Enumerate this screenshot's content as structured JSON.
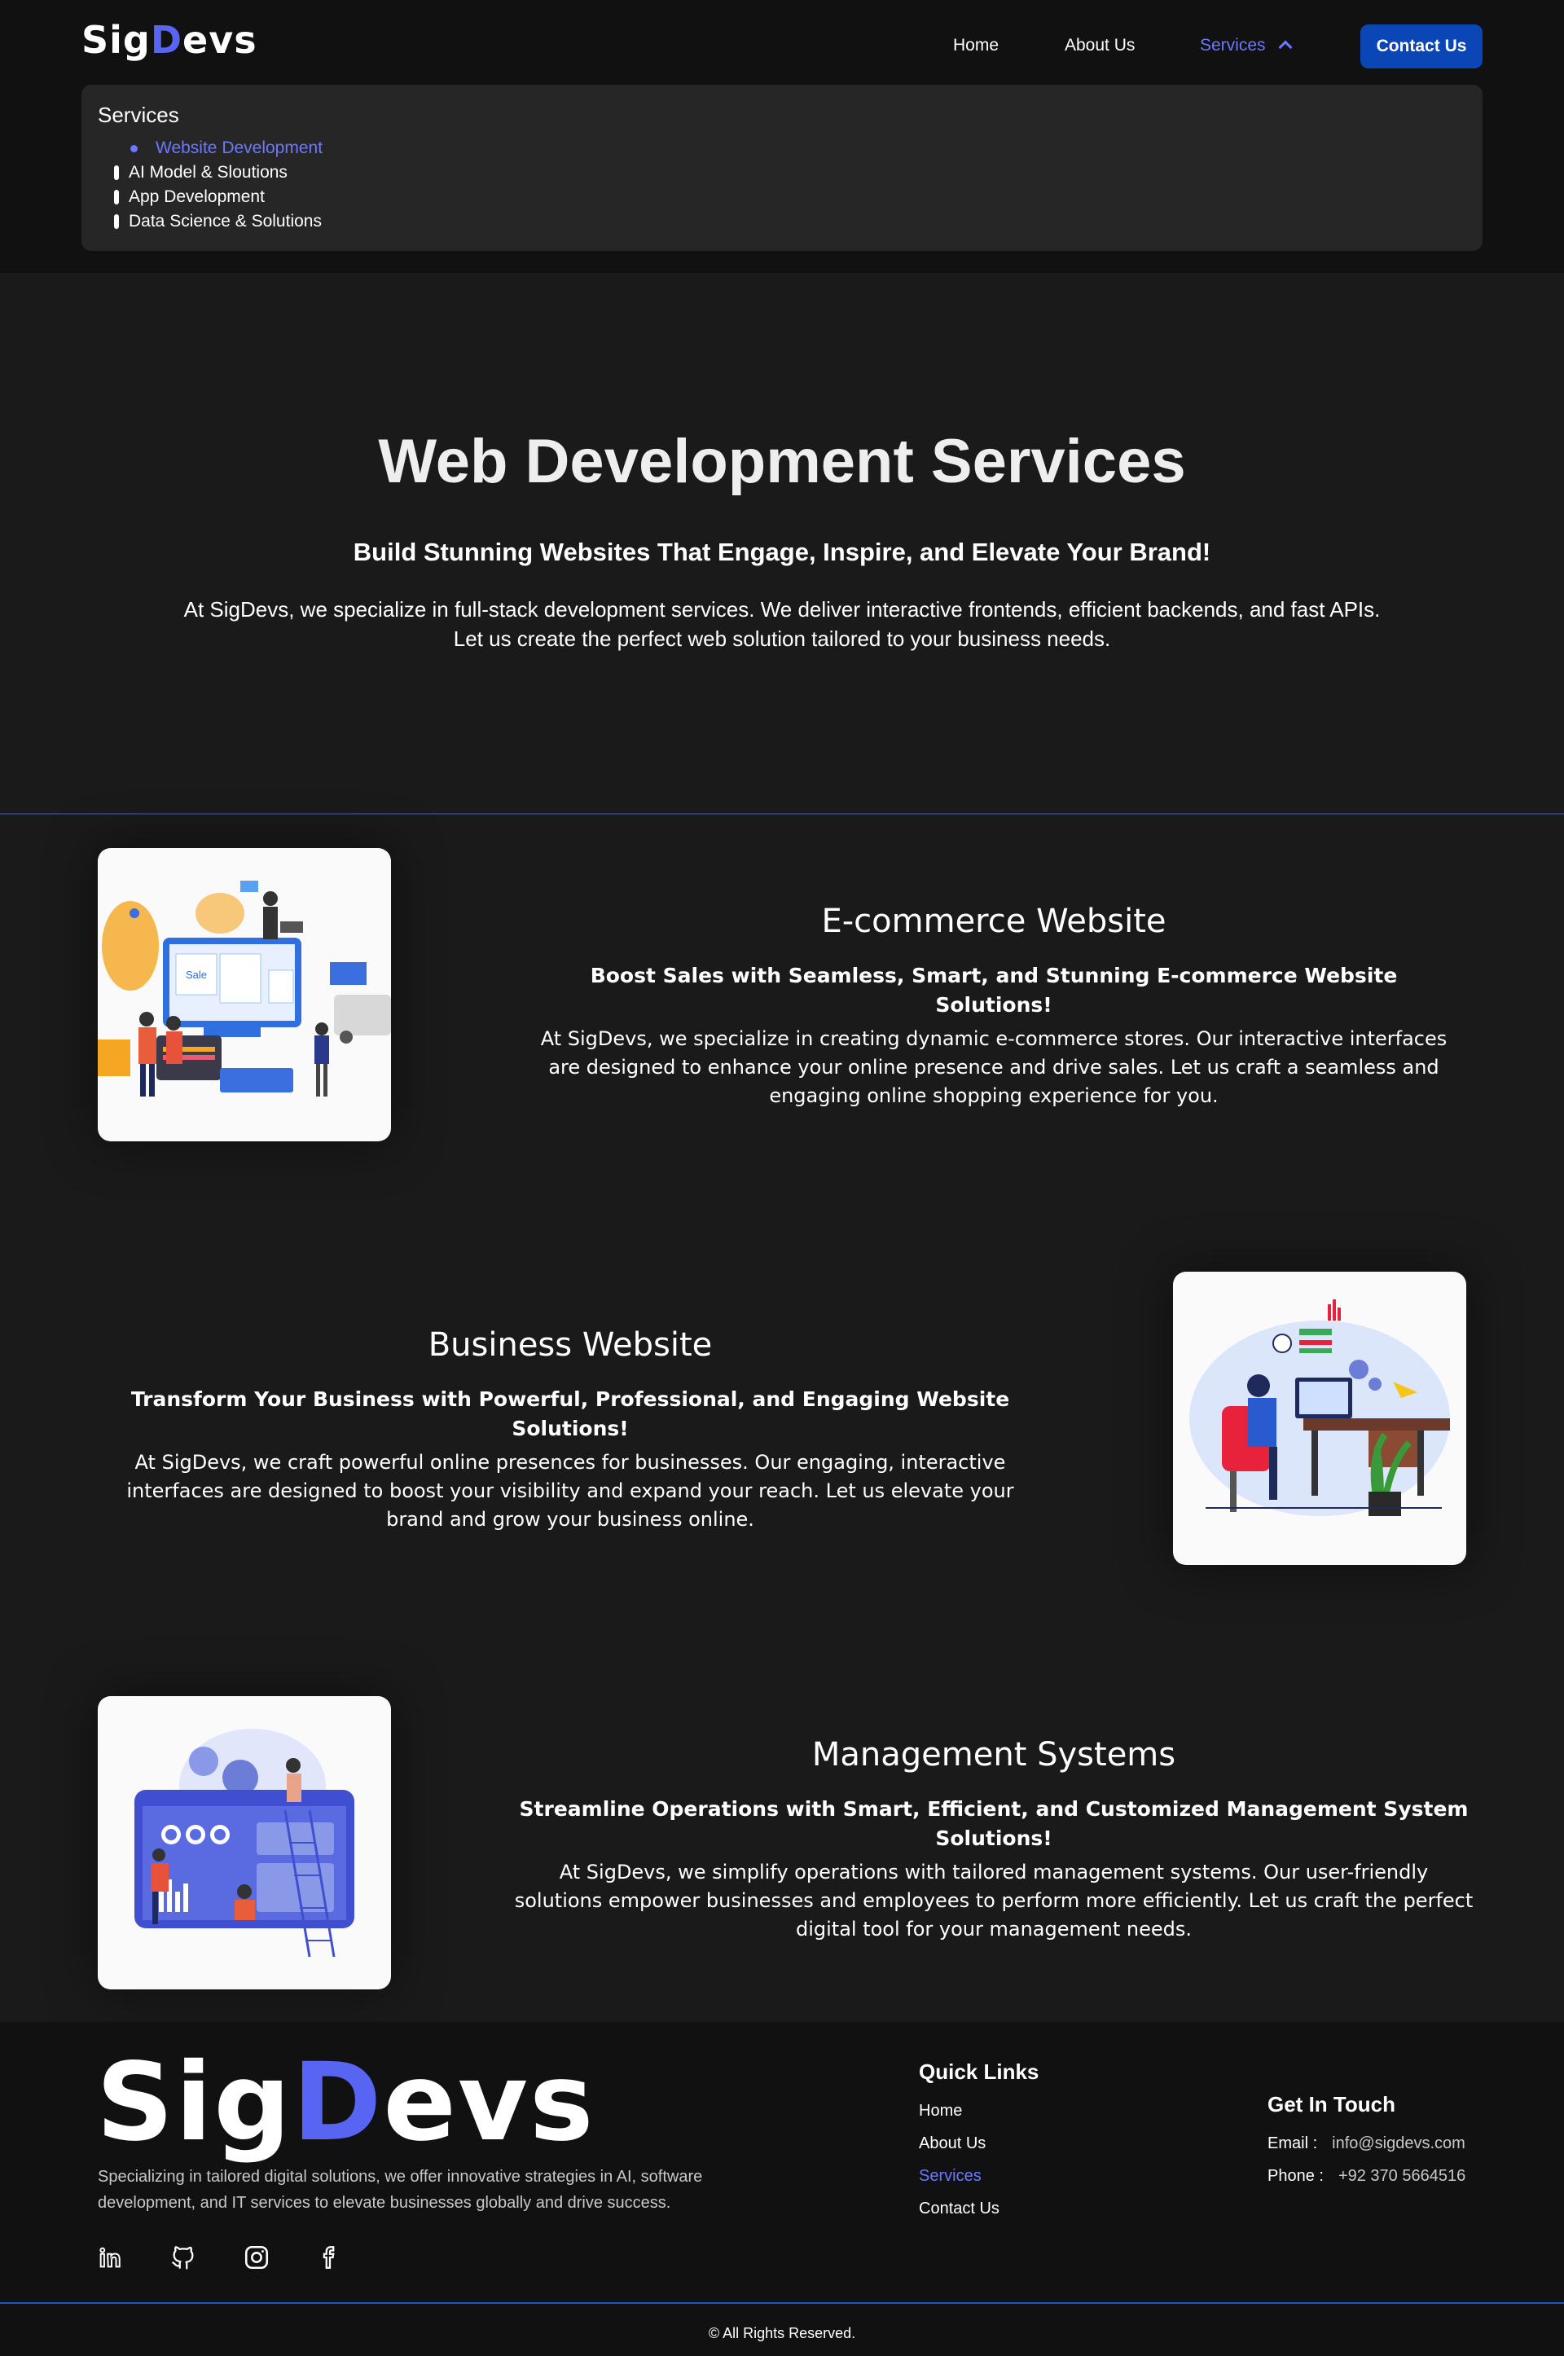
{
  "brand": {
    "prefix": "Sig",
    "accent": "D",
    "suffix": "evs",
    "accent_color": "#5865f2"
  },
  "nav": {
    "home": "Home",
    "about": "About Us",
    "services": "Services",
    "contact": "Contact Us"
  },
  "dropdown": {
    "title": "Services",
    "items": [
      "Website Development",
      "AI Model & Sloutions",
      "App Development",
      "Data Science & Solutions"
    ]
  },
  "hero": {
    "title": "Web Development Services",
    "subtitle": "Build Stunning Websites That Engage, Inspire, and Elevate Your Brand!",
    "description": "At SigDevs, we specialize in full-stack development services. We deliver interactive frontends, efficient backends, and fast APIs. Let us create the perfect web solution tailored to your business needs."
  },
  "services": [
    {
      "title": "E-commerce Website",
      "subtitle": "Boost Sales with Seamless, Smart, and Stunning E-commerce Website Solutions!",
      "description": "At SigDevs, we specialize in creating dynamic e-commerce stores. Our interactive interfaces are designed to enhance your online presence and drive sales. Let us craft a seamless and engaging online shopping experience for you.",
      "illustration_label": "Sale"
    },
    {
      "title": "Business Website",
      "subtitle": "Transform Your Business with Powerful, Professional, and Engaging Website Solutions!",
      "description": "At SigDevs, we craft powerful online presences for businesses. Our engaging, interactive interfaces are designed to boost your visibility and expand your reach. Let us elevate your brand and grow your business online."
    },
    {
      "title": "Management Systems",
      "subtitle": "Streamline Operations with Smart, Efficient, and Customized Management System Solutions!",
      "description": "At SigDevs, we simplify operations with tailored management systems. Our user-friendly solutions empower businesses and employees to perform more efficiently. Let us craft the perfect digital tool for your management needs."
    }
  ],
  "footer": {
    "about": "Specializing in tailored digital solutions, we offer innovative strategies in AI, software development, and IT services to elevate businesses globally and drive success.",
    "quick_links_title": "Quick Links",
    "quick_links": [
      "Home",
      "About Us",
      "Services",
      "Contact Us"
    ],
    "contact_title": "Get In Touch",
    "email_label": "Email :",
    "email": "info@sigdevs.com",
    "phone_label": "Phone :",
    "phone": "+92 370 5664516",
    "copyright": "© All Rights Reserved.",
    "social_icons": [
      "linkedin-icon",
      "github-icon",
      "instagram-icon",
      "facebook-icon"
    ]
  }
}
